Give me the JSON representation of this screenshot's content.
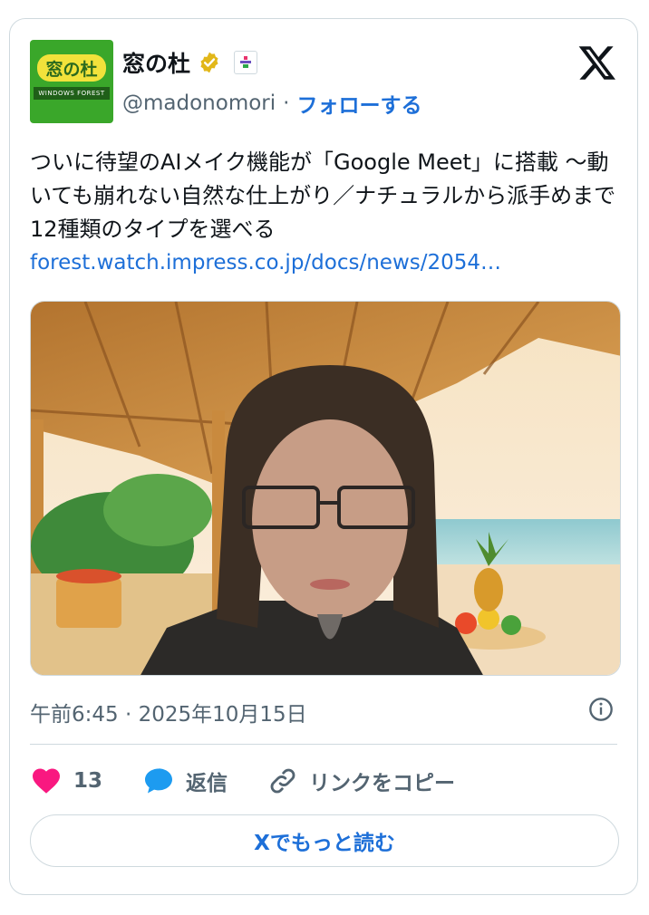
{
  "account": {
    "name": "窓の杜",
    "handle": "@madonomori",
    "separator": "·",
    "follow_label": "フォローする",
    "logo_text": "窓の杜",
    "logo_subtext": "WINDOWS FOREST"
  },
  "tweet": {
    "text": "ついに待望のAIメイク機能が「Google Meet」に搭載 〜動いても崩れない自然な仕上がり／ナチュラルから派手めまで12種類のタイプを選べる",
    "link": "forest.watch.impress.co.jp/docs/news/2054…",
    "timestamp": "午前6:45 · 2025年10月15日"
  },
  "actions": {
    "likes": "13",
    "reply_label": "返信",
    "copy_link_label": "リンクをコピー"
  },
  "read_more_label": "Xでもっと読む",
  "colors": {
    "accent": "#1d6fd8",
    "heart": "#f91880",
    "reply": "#1d9bf0",
    "border": "#cfd9de",
    "muted": "#536471"
  },
  "icons": [
    "verified-badge-icon",
    "affiliate-badge-icon",
    "x-logo-icon",
    "info-icon",
    "heart-icon",
    "reply-icon",
    "link-icon"
  ]
}
